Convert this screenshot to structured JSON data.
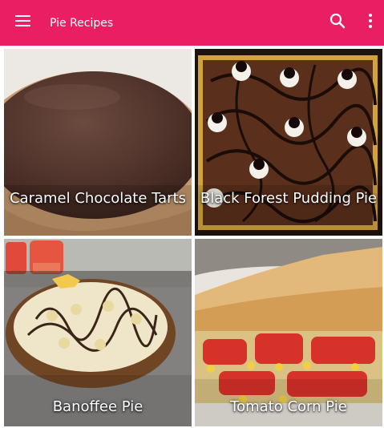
{
  "theme": {
    "accent": "#e91e63"
  },
  "appbar": {
    "title": "Pie Recipes",
    "icons": {
      "menu": "hamburger-menu-icon",
      "search": "search-icon",
      "more": "more-vertical-icon"
    }
  },
  "recipes": [
    {
      "name": "Caramel Chocolate Tarts"
    },
    {
      "name": "Black Forest Pudding Pie"
    },
    {
      "name": "Banoffee Pie"
    },
    {
      "name": "Tomato Corn Pie"
    }
  ]
}
